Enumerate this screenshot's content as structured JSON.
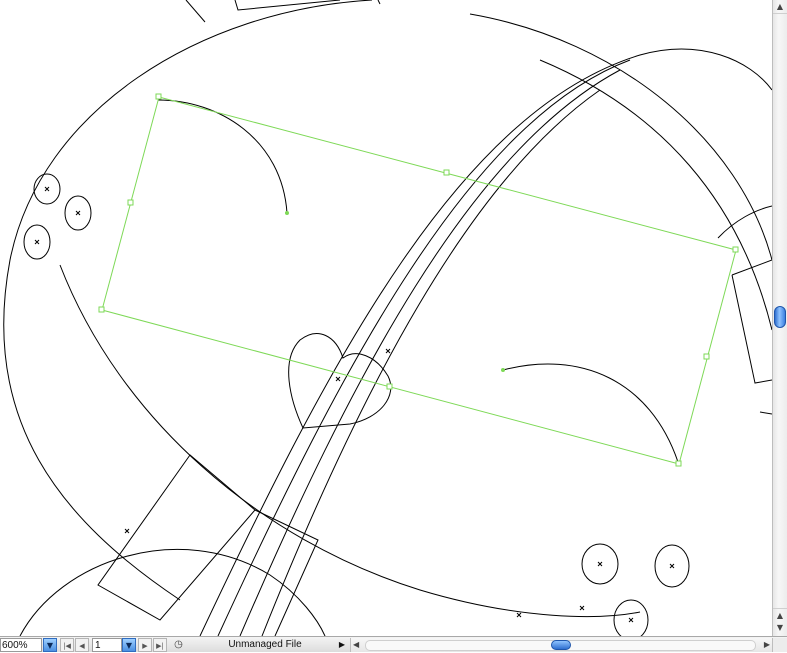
{
  "window": {
    "zoom_value": "600%",
    "page_value": "1",
    "status_text": "Unmanaged File"
  },
  "icons": {
    "dropdown": "triangle-down",
    "first_page": "first-page",
    "prev_page": "prev-page",
    "next_page": "next-page",
    "last_page": "last-page",
    "status": "clock-icon",
    "status_menu": "triangle-right",
    "scroll_up": "up-arrow",
    "scroll_down": "down-arrow",
    "scroll_left": "left-arrow",
    "scroll_right": "right-arrow"
  },
  "colors": {
    "selection": "#7ed957",
    "artwork_stroke": "#000000",
    "scroll_thumb": "#4a90e2",
    "canvas": "#ffffff"
  }
}
